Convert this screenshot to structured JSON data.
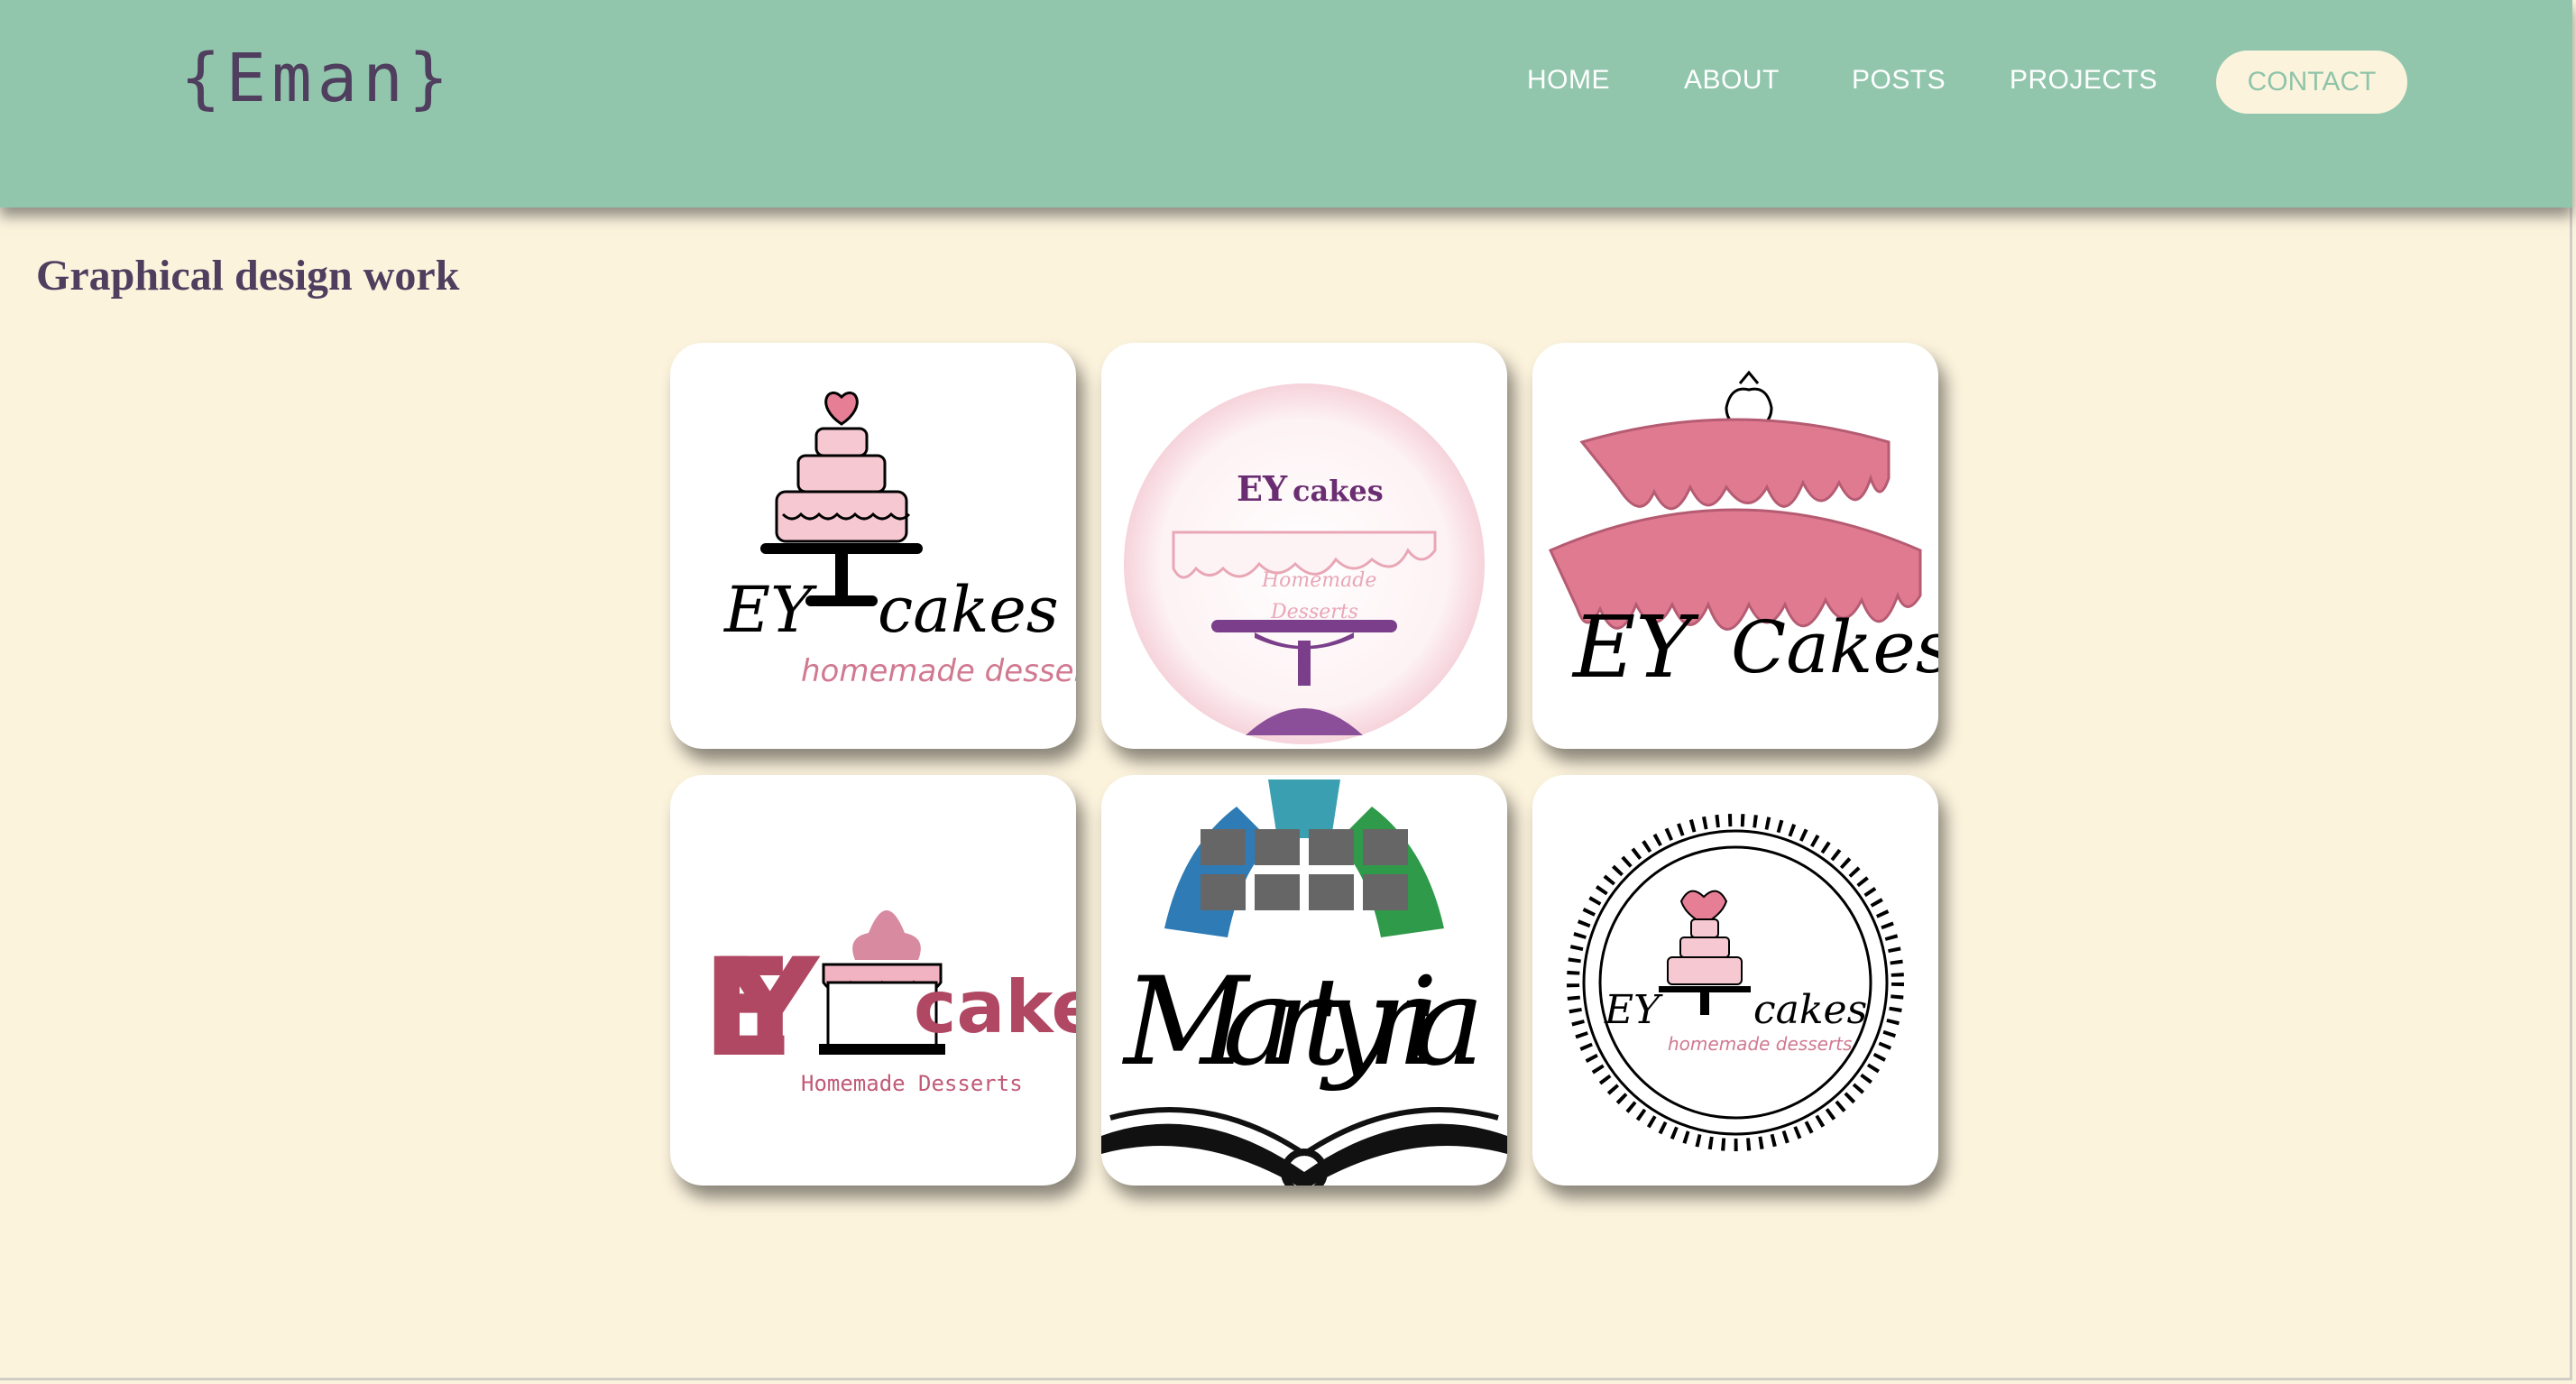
{
  "site": {
    "logo": "{Eman}"
  },
  "nav": {
    "home": "HOME",
    "about": "ABOUT",
    "posts": "POSTS",
    "projects": "PROJECTS",
    "contact": "CONTACT"
  },
  "section": {
    "title": "Graphical design work"
  },
  "gallery": {
    "items": [
      {
        "name": "EY cakes logo with tiered cake",
        "text": [
          "EY",
          "cakes",
          "homemade desserts"
        ]
      },
      {
        "name": "EY cakes circular purple logo",
        "text": [
          "EY",
          "cakes",
          "Homemade",
          "Desserts"
        ]
      },
      {
        "name": "EY Cakes pink drip logo",
        "text": [
          "EY",
          "Cakes"
        ]
      },
      {
        "name": "EY cakes red cupcake logo",
        "text": [
          "EY",
          "cakes",
          "Homemade Desserts"
        ]
      },
      {
        "name": "Martyria globe book logo",
        "text": [
          "Martyria"
        ]
      },
      {
        "name": "EY cakes lace frame logo",
        "text": [
          "EY",
          "cakes",
          "homemade desserts"
        ]
      }
    ]
  },
  "colors": {
    "header": "#91c6ad",
    "background": "#fcf3dd",
    "text": "#4f3e5e",
    "pink": "#e67e95"
  }
}
